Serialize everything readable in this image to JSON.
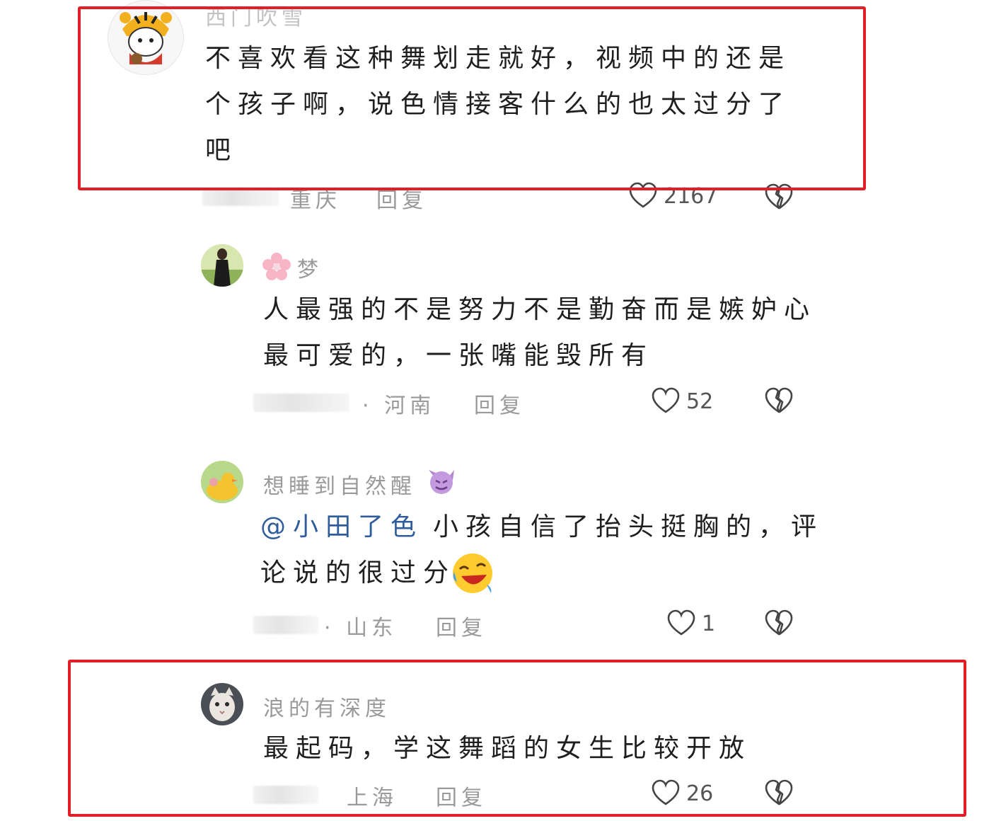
{
  "comments": [
    {
      "username": "西门吹雪",
      "lines": [
        "不喜欢看这种舞划走就好，视频中的还是",
        "个孩子啊，说色情接客什么的也太过分了",
        "吧"
      ],
      "location": "重庆",
      "reply": "回复",
      "likes": "2167",
      "avatar_icon": "tiger-girl-avatar-icon"
    },
    {
      "username": "梦",
      "username_prefix_icon": "cherry-blossom-icon",
      "lines": [
        "人最强的不是努力不是勤奋而是嫉妒心",
        "最可爱的，一张嘴能毁所有"
      ],
      "location": "· 河南",
      "reply": "回复",
      "likes": "52",
      "avatar_icon": "woman-photo-avatar-icon"
    },
    {
      "username": "想睡到自然醒",
      "username_suffix_icon": "purple-devil-emoji-icon",
      "mention": "@小田了色",
      "lines": [
        "小孩自信了抬头挺胸的，评",
        "论说的很过分"
      ],
      "line2_suffix_icon": "rolling-laughing-emoji-icon",
      "location": "· 山东",
      "reply": "回复",
      "likes": "1",
      "avatar_icon": "duck-photo-avatar-icon"
    },
    {
      "username": "浪的有深度",
      "lines": [
        "最起码，学这舞蹈的女生比较开放"
      ],
      "location": "上海",
      "reply": "回复",
      "likes": "26",
      "avatar_icon": "cat-photo-avatar-icon"
    }
  ],
  "colors": {
    "highlight_frame": "#e21f26",
    "mention": "#2f5d9c",
    "meta_text": "#9a9a9a"
  }
}
